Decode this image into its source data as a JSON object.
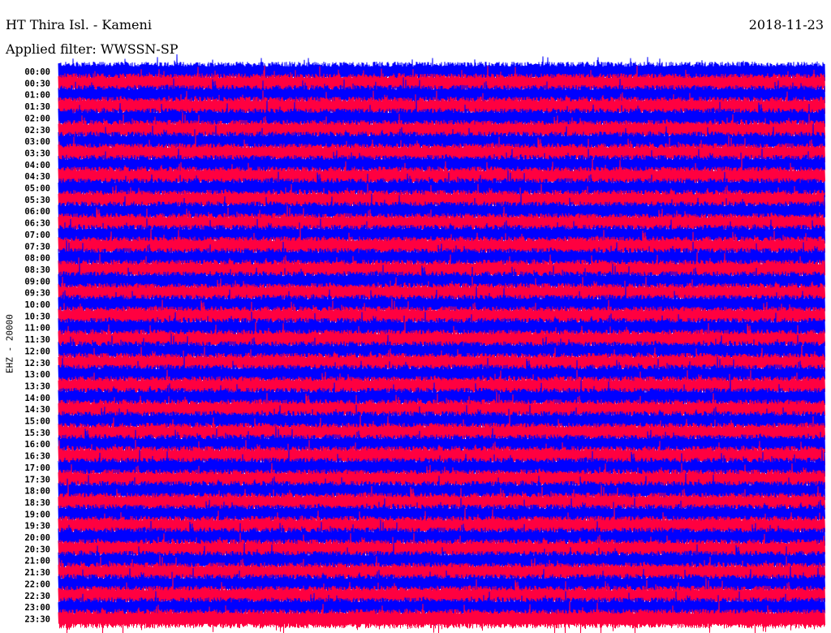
{
  "header": {
    "station": "HT Thira Isl. - Kameni",
    "date": "2018-11-23",
    "filter": "Applied filter: WWSSN-SP"
  },
  "chart_data": {
    "type": "line",
    "title": "HT Thira Isl. - Kameni",
    "subtitle": "Applied filter: WWSSN-SP",
    "ylabel": "EHZ - 20000",
    "xlabel": "",
    "row_labels": [
      "00:00",
      "00:30",
      "01:00",
      "01:30",
      "02:00",
      "02:30",
      "03:00",
      "03:30",
      "04:00",
      "04:30",
      "05:00",
      "05:30",
      "06:00",
      "06:30",
      "07:00",
      "07:30",
      "08:00",
      "08:30",
      "09:00",
      "09:30",
      "10:00",
      "10:30",
      "11:00",
      "11:30",
      "12:00",
      "12:30",
      "13:00",
      "13:30",
      "14:00",
      "14:30",
      "15:00",
      "15:30",
      "16:00",
      "16:30",
      "17:00",
      "17:30",
      "18:00",
      "18:30",
      "19:00",
      "19:30",
      "20:00",
      "20:30",
      "21:00",
      "21:30",
      "22:00",
      "22:30",
      "23:00",
      "23:30"
    ],
    "row_minutes": 30,
    "series_colors": [
      "#0000ff",
      "#ff0040"
    ],
    "grid": false
  }
}
